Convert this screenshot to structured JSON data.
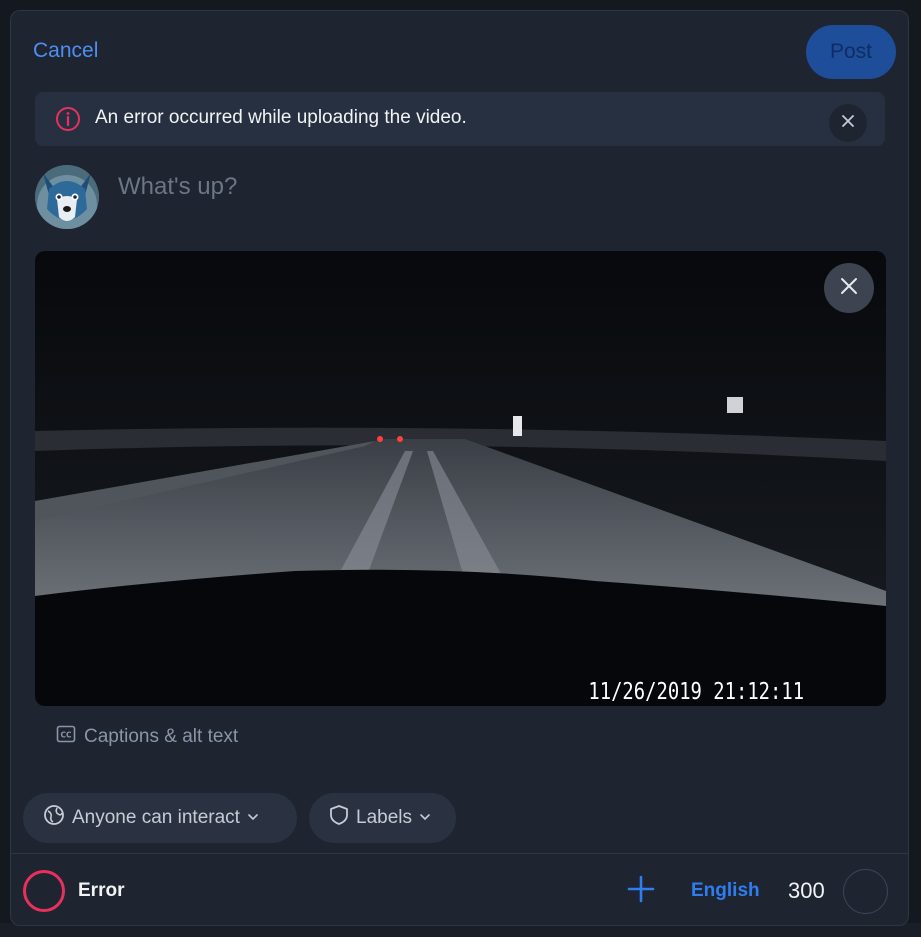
{
  "header": {
    "cancel_label": "Cancel",
    "post_label": "Post"
  },
  "error_banner": {
    "message": "An error occurred while uploading the video.",
    "icon": "info-icon",
    "close_icon": "close-icon"
  },
  "composer": {
    "placeholder": "What's up?",
    "avatar": "wolf-avatar"
  },
  "video": {
    "timestamp": "11/26/2019 21:12:11",
    "remove_icon": "close-icon"
  },
  "captions": {
    "label": "Captions & alt text",
    "icon": "cc-icon"
  },
  "controls": {
    "interaction_label": "Anyone can interact",
    "interaction_icon": "globe-icon",
    "labels_label": "Labels",
    "labels_icon": "shield-icon"
  },
  "footer": {
    "status_text": "Error",
    "language": "English",
    "char_count": "300",
    "add_icon": "plus-icon"
  },
  "colors": {
    "accent": "#2f7df0",
    "error": "#e8305f",
    "modal_bg": "#1e2430"
  }
}
